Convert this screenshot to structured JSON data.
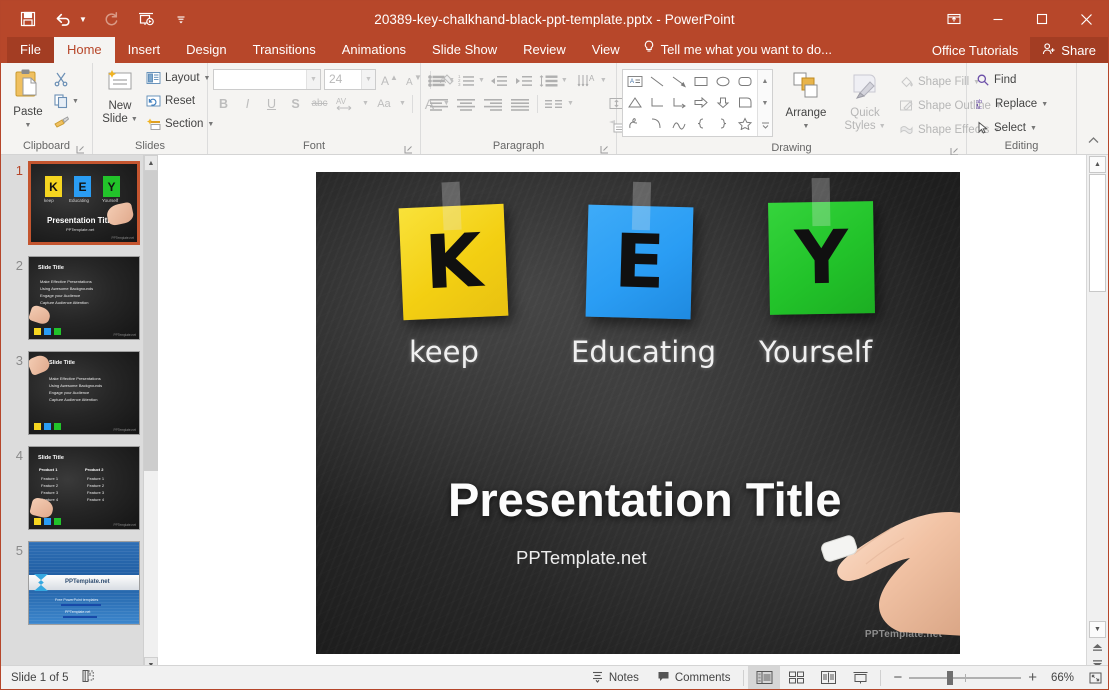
{
  "window": {
    "title": "20389-key-chalkhand-black-ppt-template.pptx - PowerPoint",
    "accent_color": "#b7472a",
    "quick_access": [
      {
        "name": "save",
        "icon": "save-icon"
      },
      {
        "name": "undo",
        "icon": "undo-icon"
      },
      {
        "name": "redo",
        "icon": "redo-icon"
      },
      {
        "name": "start-from-beginning",
        "icon": "slideshow-icon"
      },
      {
        "name": "customize-quick-access",
        "icon": "chevron-down-icon"
      }
    ],
    "controls": {
      "ribbon_display": "ribbon-display-options-icon",
      "minimize": "minimize-icon",
      "maximize": "maximize-icon",
      "close": "close-icon"
    }
  },
  "tabs": {
    "file": "File",
    "items": [
      {
        "label": "Home",
        "active": true
      },
      {
        "label": "Insert",
        "active": false
      },
      {
        "label": "Design",
        "active": false
      },
      {
        "label": "Transitions",
        "active": false
      },
      {
        "label": "Animations",
        "active": false
      },
      {
        "label": "Slide Show",
        "active": false
      },
      {
        "label": "Review",
        "active": false
      },
      {
        "label": "View",
        "active": false
      }
    ],
    "tell_me": "Tell me what you want to do...",
    "office_tutorials": "Office Tutorials",
    "share": "Share"
  },
  "ribbon": {
    "clipboard": {
      "label": "Clipboard",
      "paste": "Paste",
      "cut": "Cut",
      "copy": "Copy",
      "format_painter": "Format Painter"
    },
    "slides": {
      "label": "Slides",
      "new_slide": "New\nSlide",
      "new_slide_line1": "New",
      "new_slide_line2": "Slide",
      "layout": "Layout",
      "reset": "Reset",
      "section": "Section"
    },
    "font": {
      "label": "Font",
      "font_name": "",
      "font_name_placeholder": "",
      "font_size": "24",
      "bold": "B",
      "italic": "I",
      "underline": "U",
      "shadow": "S",
      "strikethrough": "abc",
      "char_spacing": "AV",
      "change_case": "Aa",
      "font_color": "A",
      "increase_size": "A",
      "decrease_size": "A",
      "clear_formatting": "clear-formatting-icon"
    },
    "paragraph": {
      "label": "Paragraph",
      "bullets": "bullets-icon",
      "numbering": "numbering-icon",
      "decrease_indent": "decrease-indent-icon",
      "increase_indent": "increase-indent-icon",
      "line_spacing": "line-spacing-icon",
      "text_direction": "text-direction-icon",
      "align_text": "align-text-icon",
      "convert_smartart": "smartart-icon",
      "align_left": "align-left-icon",
      "align_center": "align-center-icon",
      "align_right": "align-right-icon",
      "justify": "justify-icon",
      "columns": "columns-icon"
    },
    "drawing": {
      "label": "Drawing",
      "arrange": "Arrange",
      "quick_styles_line1": "Quick",
      "quick_styles_line2": "Styles",
      "shape_fill": "Shape Fill",
      "shape_outline": "Shape Outline",
      "shape_effects": "Shape Effects",
      "shapes": [
        [
          "text-box-shape",
          "line-shape",
          "arrow-shape",
          "rectangle-shape",
          "oval-shape",
          "rounded-rectangle-shape"
        ],
        [
          "triangle-shape",
          "elbow-connector-shape",
          "elbow-arrow-shape",
          "block-arrow-shape",
          "down-arrow-shape",
          "pentagon-shape"
        ],
        [
          "scribble-shape",
          "arc-shape",
          "curve-shape",
          "left-brace-shape",
          "right-brace-shape",
          "star-shape"
        ]
      ]
    },
    "editing": {
      "label": "Editing",
      "find": "Find",
      "replace": "Replace",
      "select": "Select",
      "collapse_ribbon": "collapse-ribbon-icon"
    }
  },
  "thumbnails": [
    {
      "number": "1",
      "selected": true,
      "type": "title",
      "title": "Presentation Title",
      "subtitle": "PPTemplate.net",
      "watermark": "PPTemplate.net",
      "notes": [
        {
          "letter": "K",
          "word": "keep",
          "color": "#f5d520"
        },
        {
          "letter": "E",
          "word": "Educating",
          "color": "#2a9df4"
        },
        {
          "letter": "Y",
          "word": "Yourself",
          "color": "#22c32a"
        }
      ]
    },
    {
      "number": "2",
      "selected": false,
      "type": "bullets",
      "title": "Slide Title",
      "bullets": [
        "Make Effective Presentations",
        "Using Awesome Backgrounds",
        "Engage your Audience",
        "Capture Audience Attention"
      ],
      "watermark": "PPTemplate.net",
      "squares": [
        "#f5d520",
        "#2a9df4",
        "#22c32a"
      ]
    },
    {
      "number": "3",
      "selected": false,
      "type": "bullets",
      "title": "Slide Title",
      "bullets": [
        "Make Effective Presentations",
        "Using Awesome Backgrounds",
        "Engage your Audience",
        "Capture Audience Attention"
      ],
      "watermark": "PPTemplate.net",
      "squares": [
        "#f5d520",
        "#2a9df4",
        "#22c32a"
      ]
    },
    {
      "number": "4",
      "selected": false,
      "type": "two-column",
      "title": "Slide Title",
      "col1_header": "Product 1",
      "col2_header": "Product 2",
      "col1": [
        "Feature 1",
        "Feature 2",
        "Feature 3",
        "Feature 4"
      ],
      "col2": [
        "Feature 1",
        "Feature 2",
        "Feature 3",
        "Feature 4"
      ],
      "watermark": "PPTemplate.net",
      "squares": [
        "#f5d520",
        "#2a9df4",
        "#22c32a"
      ]
    },
    {
      "number": "5",
      "selected": false,
      "type": "closing",
      "title": "PPTemplate.net",
      "line1": "Free PowerPoint templates",
      "line2": "PPTemplate.net"
    }
  ],
  "slide": {
    "notes": [
      {
        "letter": "K",
        "word": "keep",
        "color": "#f7dc1e",
        "color_dark": "#e8c513"
      },
      {
        "letter": "E",
        "word": "Educating",
        "color": "#2a9df4",
        "color_dark": "#2084d6"
      },
      {
        "letter": "Y",
        "word": "Yourself",
        "color": "#22c32a",
        "color_dark": "#1ba622"
      }
    ],
    "title": "Presentation Title",
    "subtitle": "PPTemplate.net",
    "watermark": "PPTemplate.net"
  },
  "status": {
    "slide_count": "Slide 1 of 5",
    "accessibility": "accessibility-checker-icon",
    "notes": "Notes",
    "comments": "Comments",
    "views": [
      {
        "name": "normal-view",
        "icon": "normal-view-icon",
        "active": true
      },
      {
        "name": "slide-sorter-view",
        "icon": "slide-sorter-icon",
        "active": false
      },
      {
        "name": "reading-view",
        "icon": "reading-view-icon",
        "active": false
      },
      {
        "name": "slide-show-view",
        "icon": "slide-show-icon",
        "active": false
      }
    ],
    "zoom_out": "−",
    "zoom_in": "+",
    "zoom_level": "66%",
    "fit_to_window": "fit-slide-icon"
  }
}
